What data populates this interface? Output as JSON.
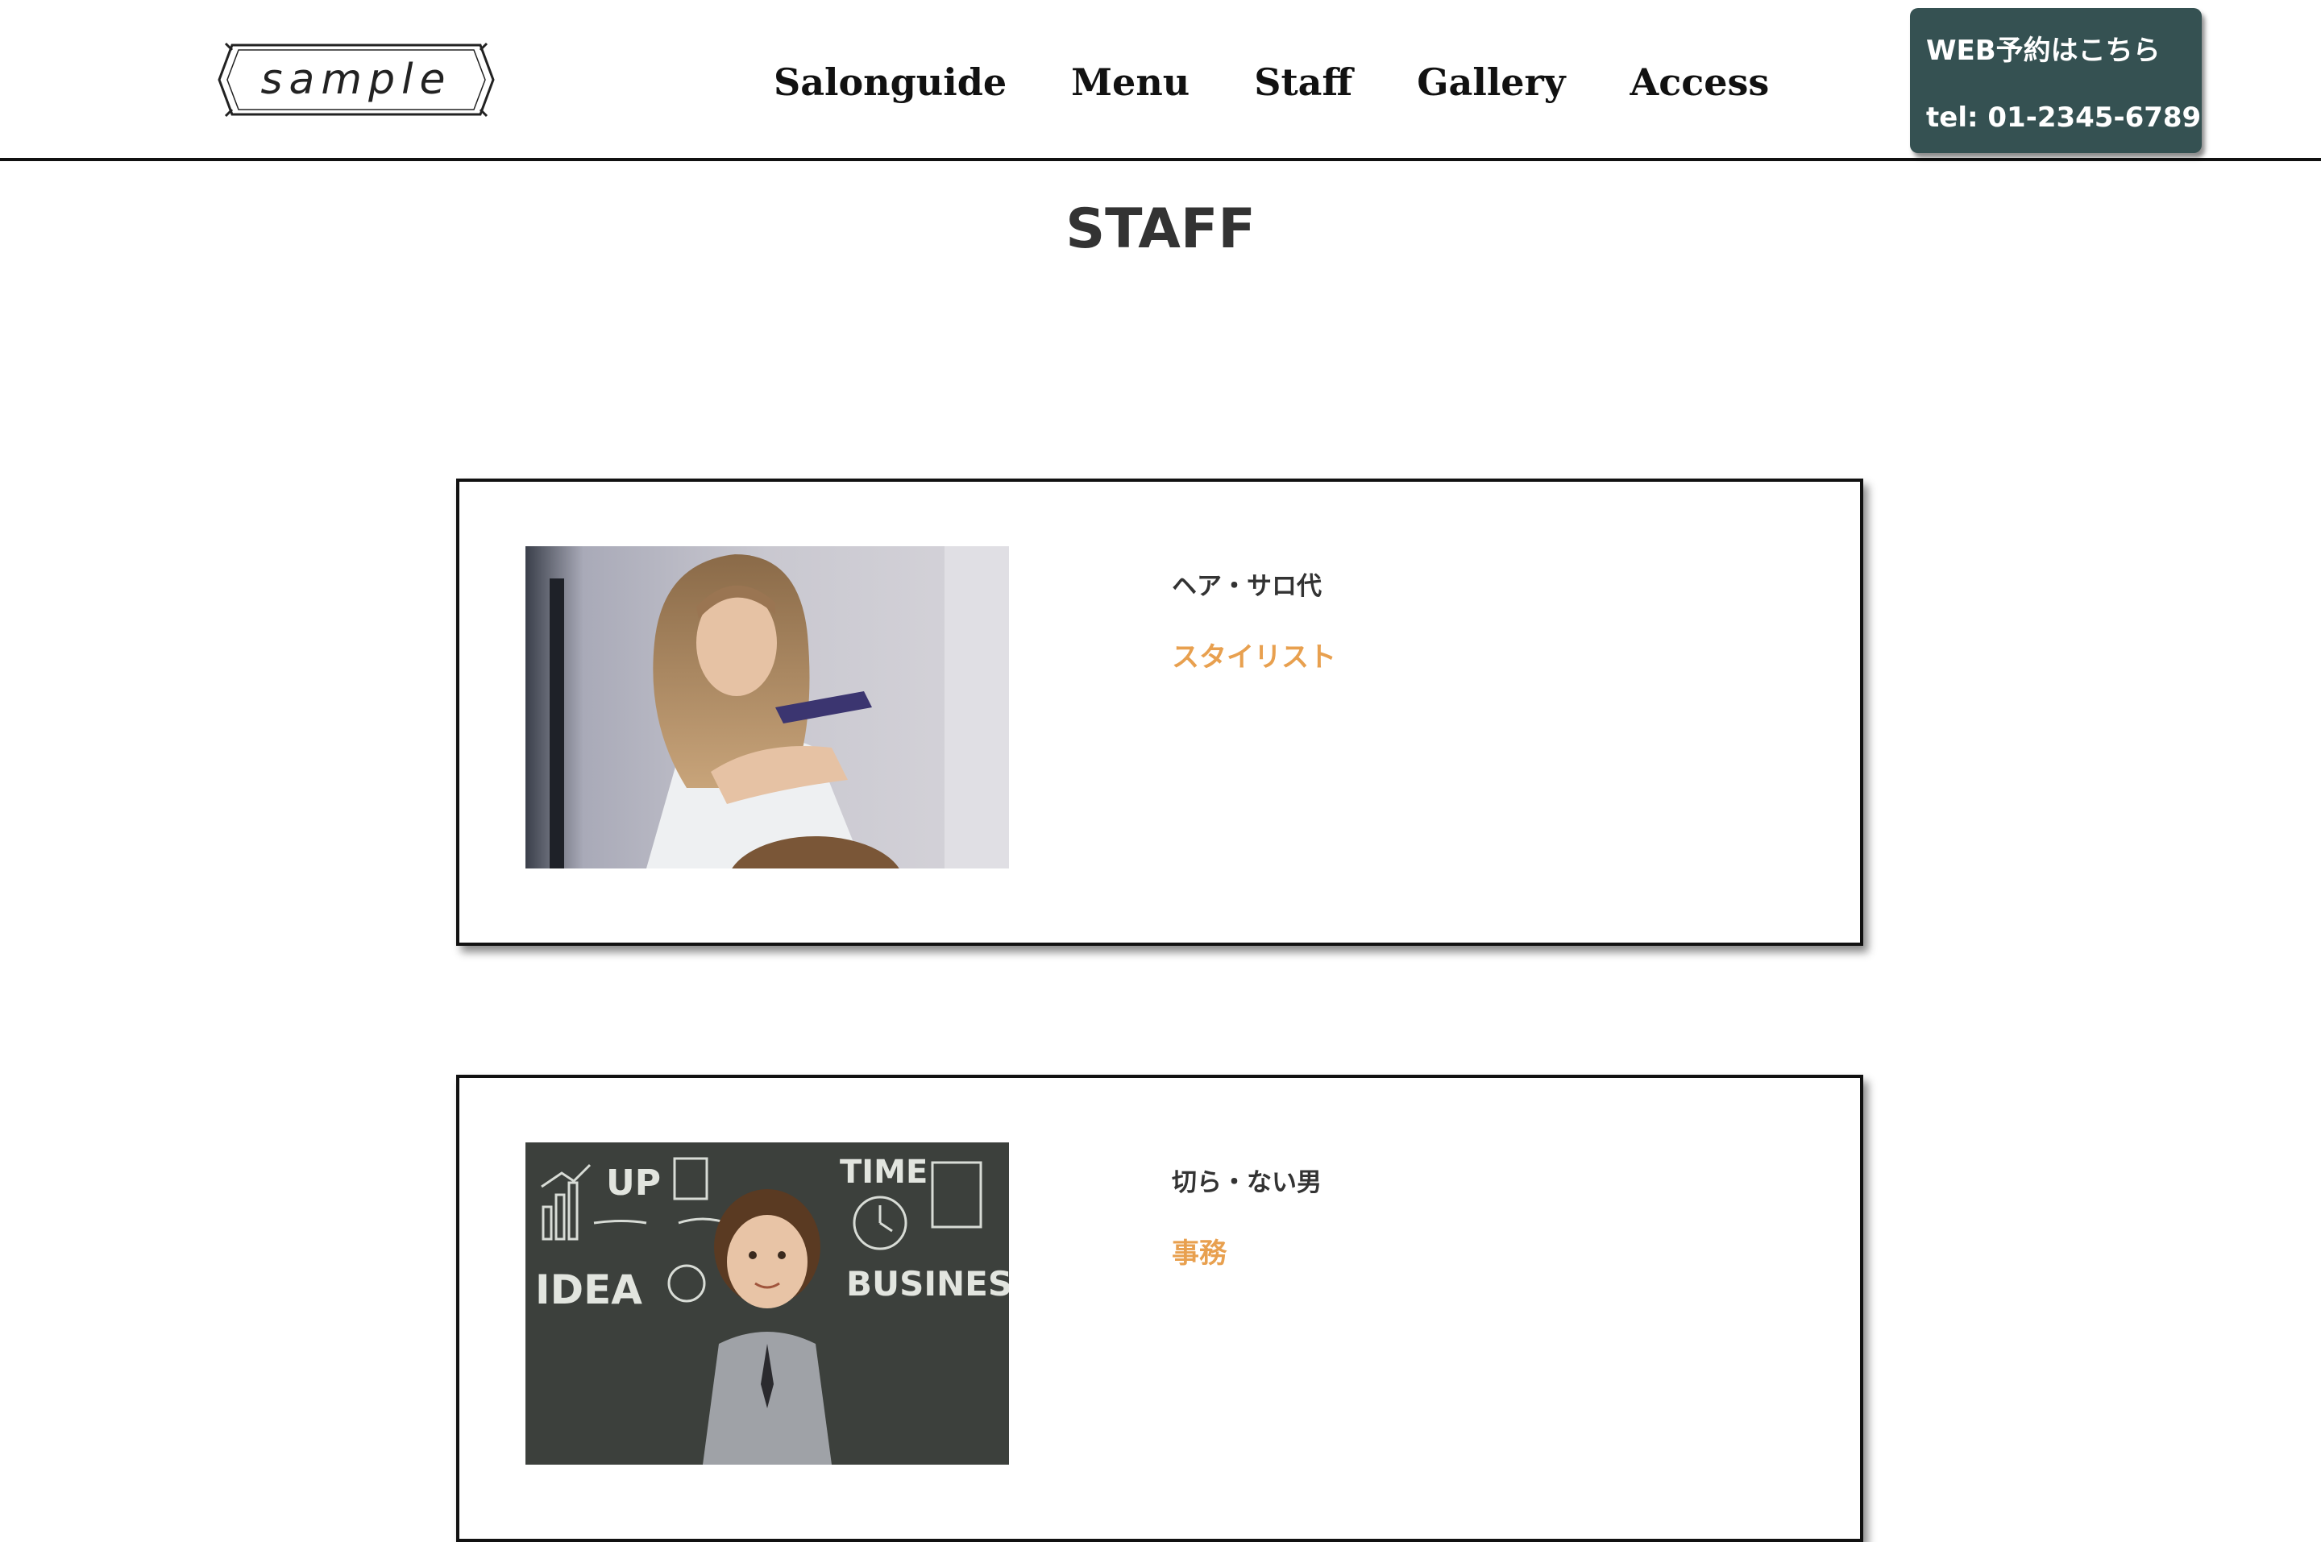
{
  "header": {
    "logo_text": "sample",
    "nav": [
      {
        "label": "Salonguide"
      },
      {
        "label": "Menu"
      },
      {
        "label": "Staff"
      },
      {
        "label": "Gallery"
      },
      {
        "label": "Access"
      }
    ],
    "reserve": {
      "web_label": "WEB予約はこちら",
      "tel_label": "tel: 01-2345-6789",
      "background": "#355152"
    }
  },
  "page": {
    "title": "STAFF"
  },
  "staff": [
    {
      "name": "ヘア・サロ代",
      "role": "スタイリスト",
      "photo": "stylist-combing-hair-photo"
    },
    {
      "name": "切ら・ない男",
      "role": "事務",
      "photo": "boy-chalkboard-business-photo",
      "photo_words": [
        "UP",
        "TIME",
        "IDEA",
        "BUSINESS"
      ]
    }
  ],
  "colors": {
    "role_accent": "#e8a04f",
    "text": "#333333"
  }
}
